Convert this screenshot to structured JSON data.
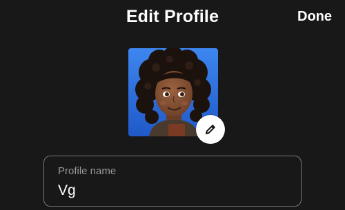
{
  "header": {
    "title": "Edit Profile",
    "done_label": "Done"
  },
  "avatar": {
    "icon": "pencil-icon",
    "background_color": "#2f6fe0"
  },
  "profile_name": {
    "label": "Profile name",
    "value": "Vg"
  },
  "colors": {
    "background": "#181818",
    "text": "#ffffff",
    "field_border": "#7a7a7a",
    "label": "#9a9a9a"
  }
}
